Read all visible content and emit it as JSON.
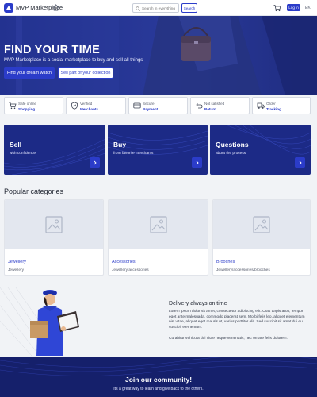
{
  "header": {
    "brand": "MVP Marketplace",
    "search_placeholder": "Search in everything",
    "search_button": "Search",
    "login": "Log in",
    "lang": "EK"
  },
  "hero": {
    "title": "FIND YOUR TIME",
    "subtitle": "MVP Marketplace is a social marketplace to buy and sell all things",
    "primary_button": "Find your dream watch",
    "secondary_button": "Sell part of your collection"
  },
  "features": [
    {
      "line1": "Safe online",
      "line2": "Shopping",
      "icon": "cart-icon"
    },
    {
      "line1": "Verified",
      "line2": "Merchants",
      "icon": "verified-badge-icon"
    },
    {
      "line1": "Secure",
      "line2": "Payment",
      "icon": "credit-card-icon"
    },
    {
      "line1": "Not satisfied",
      "line2": "Return",
      "icon": "return-icon"
    },
    {
      "line1": "Order",
      "line2": "Tracking",
      "icon": "tracking-icon"
    }
  ],
  "actions": [
    {
      "title": "Sell",
      "subtitle": "with confidence"
    },
    {
      "title": "Buy",
      "subtitle": "from favorite merchants"
    },
    {
      "title": "Questions",
      "subtitle": "about the process"
    }
  ],
  "categories": {
    "title": "Popular categories",
    "items": [
      {
        "name": "Jewellery",
        "desc": "Jewellery"
      },
      {
        "name": "Accessories",
        "desc": "Jewellery/accessories"
      },
      {
        "name": "Brooches",
        "desc": "Jewellery/accessories/brooches"
      }
    ]
  },
  "delivery": {
    "title": "Delivery always on time",
    "paragraph1": "Lorem ipsum dolor sit amet, consectetur adipiscing elit. Cras turpis arcu, tempor eget ante malesuada, commodo placerat sem. Morbi felis leo, aliquet elementum nisl vitae, aliquet eget mauris ut, varius porttitor elit. Sed suscipit sit amet dui eu suscipit elementum.",
    "paragraph2": "Curabitur vehicula dui vitae neque venenatis, nec ornare felis dolorem."
  },
  "community": {
    "title": "Join our community!",
    "subtitle": "Its a great way to learn and give back to the others."
  },
  "colors": {
    "primary": "#2b3cc9",
    "dark_blue": "#1c2a86",
    "background": "#f1f3f6"
  }
}
